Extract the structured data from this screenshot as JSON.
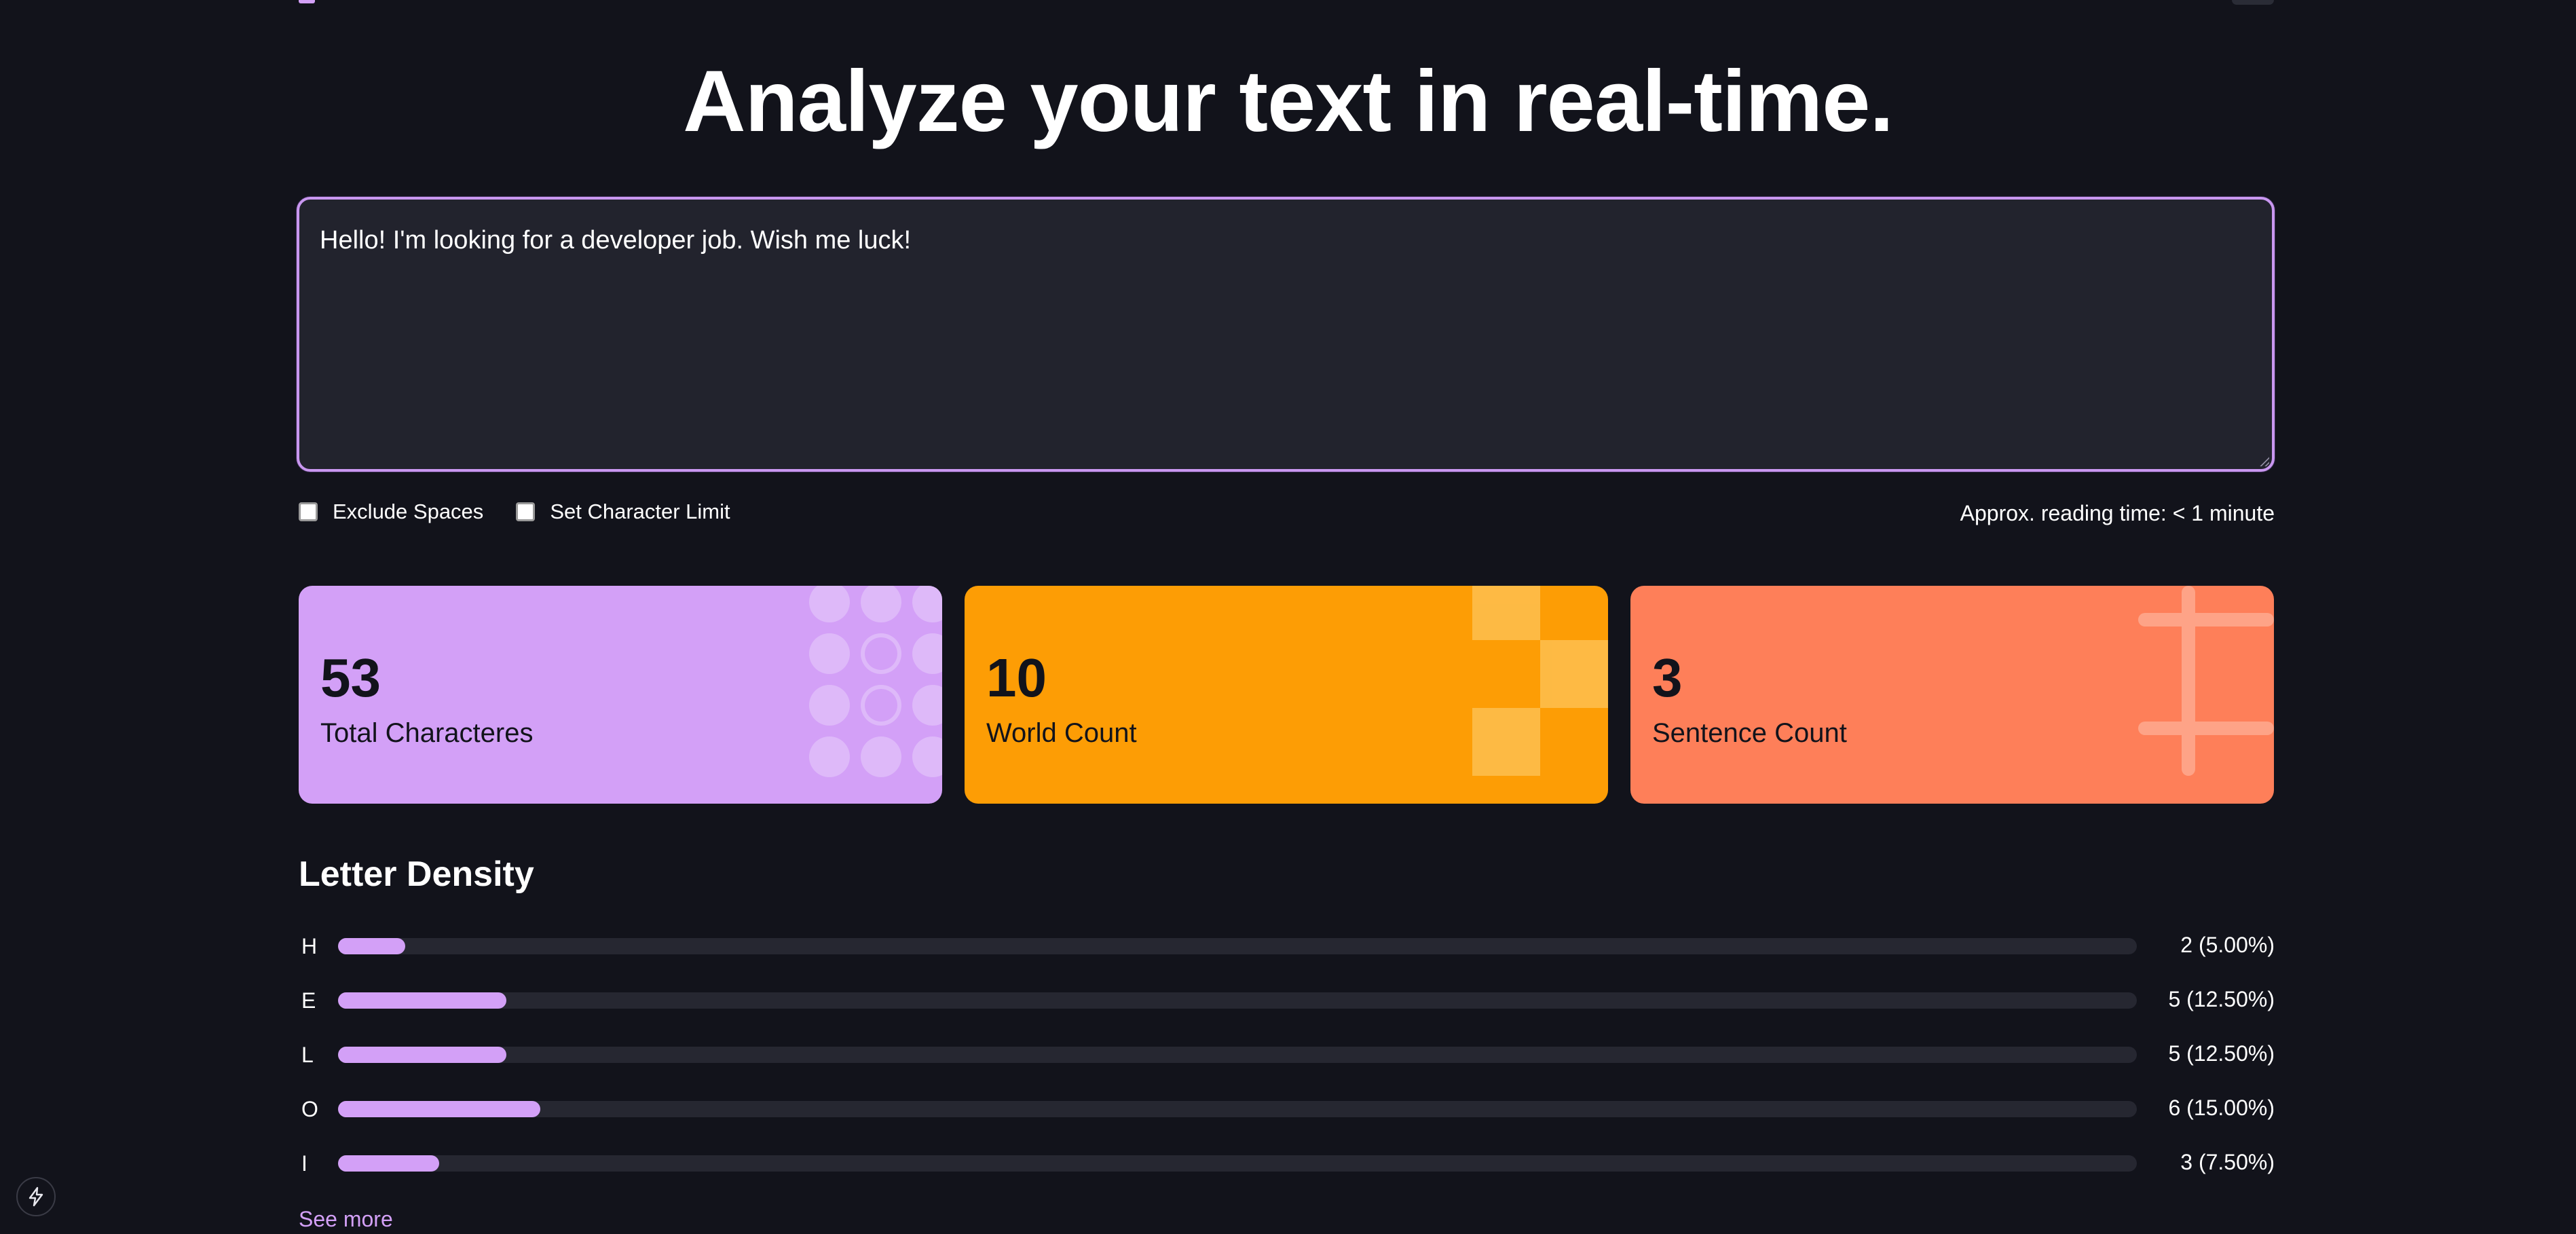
{
  "header": {
    "title": "Analyze your text in real-time."
  },
  "editor": {
    "value": "Hello! I'm looking for a developer job. Wish me luck!"
  },
  "options": {
    "exclude_spaces": {
      "label": "Exclude Spaces",
      "checked": false
    },
    "char_limit": {
      "label": "Set Character Limit",
      "checked": false
    }
  },
  "reading_time": "Approx. reading time: < 1 minute",
  "stats": [
    {
      "value": "53",
      "label": "Total Characteres",
      "color": "#d3a0f7"
    },
    {
      "value": "10",
      "label": "World Count",
      "color": "#fd9d05"
    },
    {
      "value": "3",
      "label": "Sentence Count",
      "color": "#fe7f59"
    }
  ],
  "density": {
    "title": "Letter Density",
    "items": [
      {
        "letter": "H",
        "count": "2 (5.00%)",
        "percent": 5.0
      },
      {
        "letter": "E",
        "count": "5 (12.50%)",
        "percent": 12.5
      },
      {
        "letter": "L",
        "count": "5 (12.50%)",
        "percent": 12.5
      },
      {
        "letter": "O",
        "count": "6 (15.00%)",
        "percent": 15.0
      },
      {
        "letter": "I",
        "count": "3 (7.50%)",
        "percent": 7.5
      }
    ],
    "see_more": "See more"
  },
  "colors": {
    "accent": "#d3a0f7",
    "background": "#12131b",
    "surface": "#22232d"
  },
  "icons": {
    "fab": "lightning-icon"
  }
}
